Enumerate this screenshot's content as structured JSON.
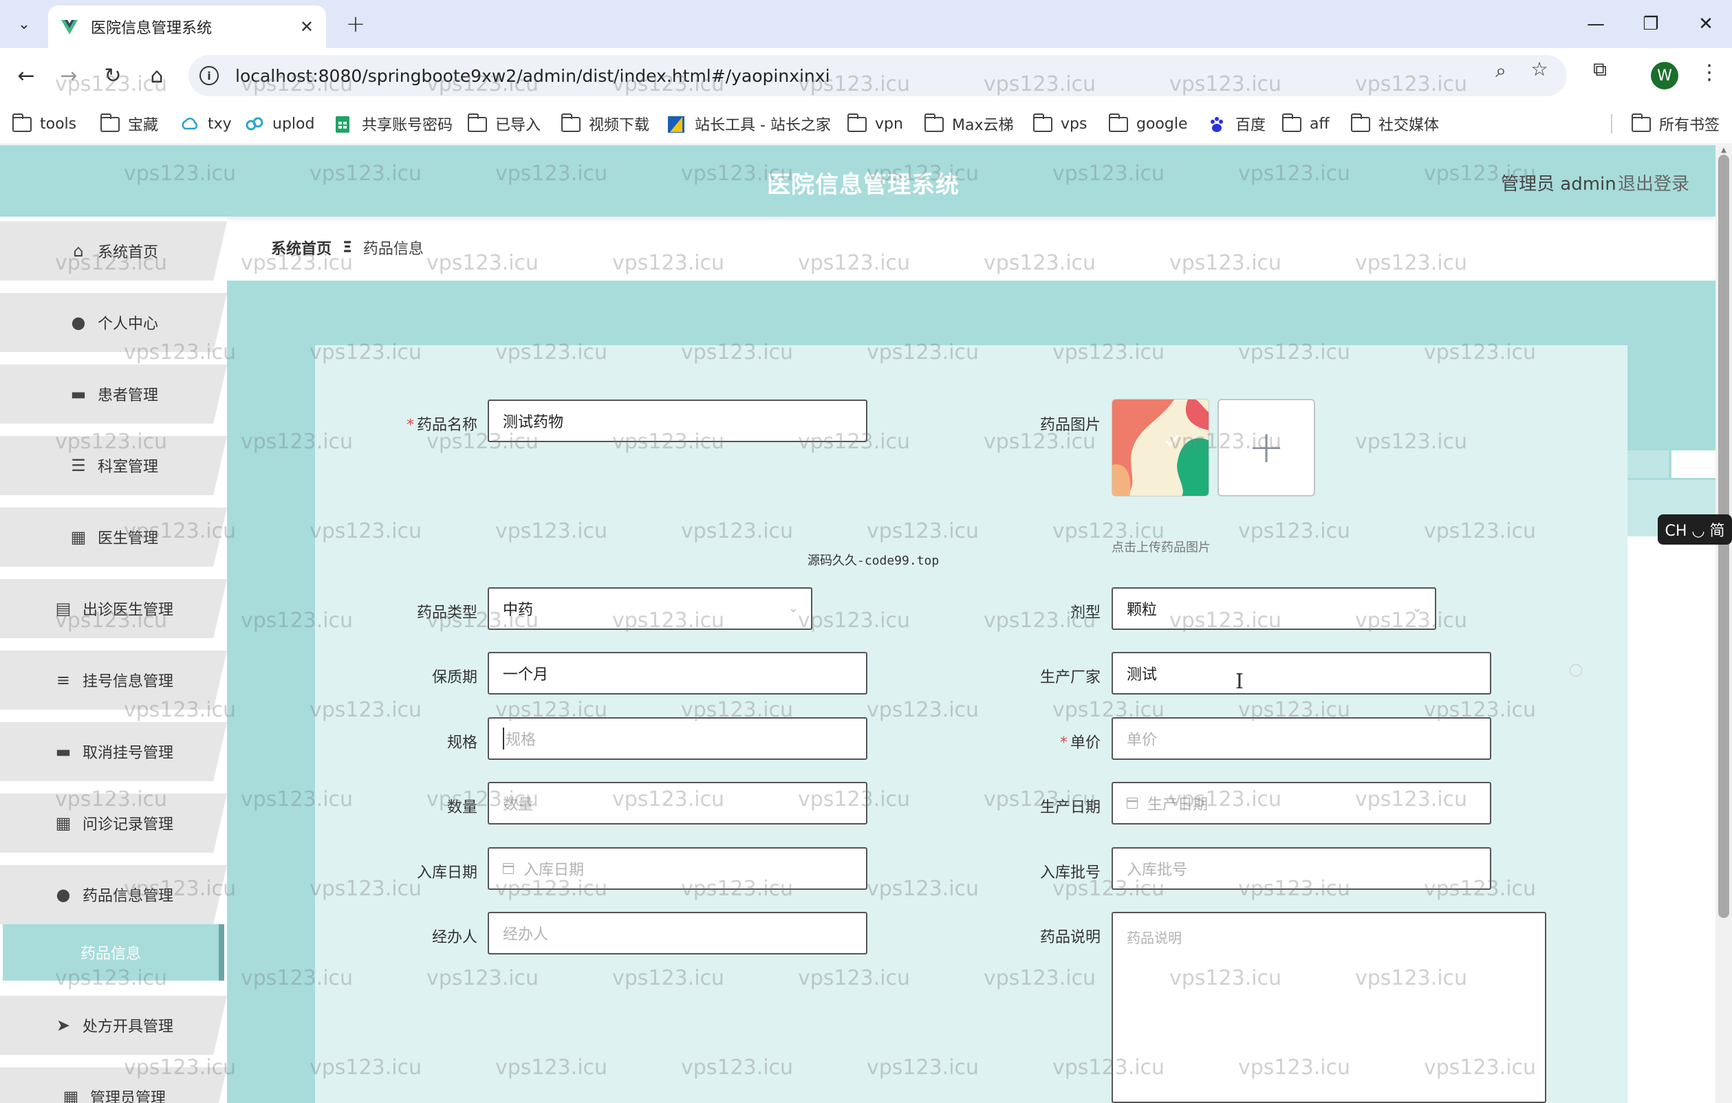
{
  "browser": {
    "tab_title": "医院信息管理系统",
    "url": "localhost:8080/springboote9xw2/admin/dist/index.html#/yaopinxinxi",
    "bookmarks": [
      {
        "label": "tools",
        "icon": "folder-icon"
      },
      {
        "label": "宝藏",
        "icon": "folder-icon"
      },
      {
        "label": "txy",
        "icon": "cloud-icon"
      },
      {
        "label": "uplod",
        "icon": "link-icon"
      },
      {
        "label": "共享账号密码",
        "icon": "sheet-icon"
      },
      {
        "label": "已导入",
        "icon": "folder-icon"
      },
      {
        "label": "视频下载",
        "icon": "folder-icon"
      },
      {
        "label": "站长工具 - 站长之家",
        "icon": "site-icon"
      },
      {
        "label": "vpn",
        "icon": "folder-icon"
      },
      {
        "label": "Max云梯",
        "icon": "folder-icon"
      },
      {
        "label": "vps",
        "icon": "folder-icon"
      },
      {
        "label": "google",
        "icon": "folder-icon"
      },
      {
        "label": "百度",
        "icon": "baidu-icon"
      },
      {
        "label": "aff",
        "icon": "folder-icon"
      },
      {
        "label": "社交媒体",
        "icon": "folder-icon"
      }
    ],
    "all_bookmarks": "所有书签",
    "profile_initial": "W"
  },
  "header": {
    "title": "医院信息管理系统",
    "user": "管理员 admin",
    "logout": "退出登录"
  },
  "sidebar": {
    "items": [
      {
        "label": "系统首页",
        "icon": "home-icon"
      },
      {
        "label": "个人中心",
        "icon": "user-icon"
      },
      {
        "label": "患者管理",
        "icon": "briefcase-icon"
      },
      {
        "label": "科室管理",
        "icon": "sliders-icon"
      },
      {
        "label": "医生管理",
        "icon": "grid-icon"
      },
      {
        "label": "出诊医生管理",
        "icon": "clipboard-icon"
      },
      {
        "label": "挂号信息管理",
        "icon": "list-icon"
      },
      {
        "label": "取消挂号管理",
        "icon": "inbox-icon"
      },
      {
        "label": "问诊记录管理",
        "icon": "grid-icon"
      },
      {
        "label": "药品信息管理",
        "icon": "user-icon"
      },
      {
        "label": "处方开具管理",
        "icon": "send-icon"
      },
      {
        "label": "管理员管理",
        "icon": "grid-icon"
      }
    ],
    "active_sub": "药品信息"
  },
  "breadcrumb": {
    "home": "系统首页",
    "current": "药品信息"
  },
  "form": {
    "name_label": "药品名称",
    "name_value": "测试药物",
    "image_label": "药品图片",
    "image_tip": "点击上传药品图片",
    "code_note": "源码久久-code99.top",
    "type_label": "药品类型",
    "type_value": "中药",
    "dosage_label": "剂型",
    "dosage_value": "颗粒",
    "shelf_label": "保质期",
    "shelf_value": "一个月",
    "maker_label": "生产厂家",
    "maker_value": "测试",
    "spec_label": "规格",
    "spec_placeholder": "规格",
    "price_label": "单价",
    "price_placeholder": "单价",
    "qty_label": "数量",
    "qty_placeholder": "数量",
    "prod_date_label": "生产日期",
    "prod_date_placeholder": "生产日期",
    "in_date_label": "入库日期",
    "in_date_placeholder": "入库日期",
    "batch_label": "入库批号",
    "batch_placeholder": "入库批号",
    "handler_label": "经办人",
    "handler_placeholder": "经办人",
    "desc_label": "药品说明",
    "desc_placeholder": "药品说明"
  },
  "ime": "CH ◡ 简",
  "watermark": "vps123.icu",
  "colors": {
    "accent": "#a7dcdb",
    "card": "#def2f1",
    "sidebar_item": "#e6e6e6"
  }
}
